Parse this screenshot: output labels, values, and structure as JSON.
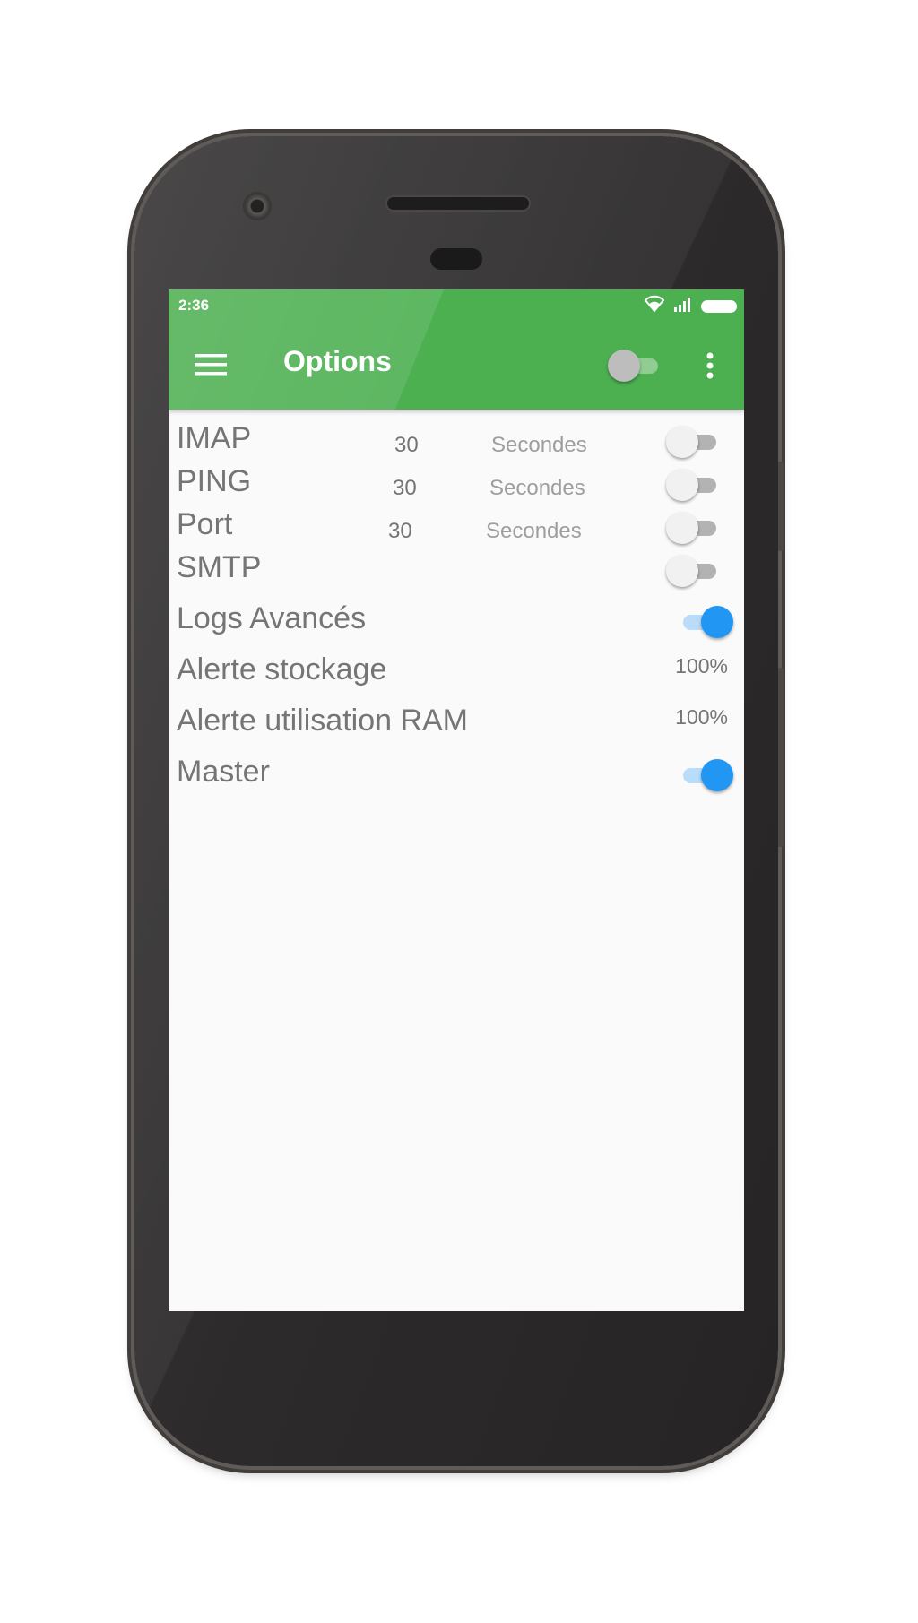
{
  "status_bar": {
    "time": "2:36"
  },
  "app_bar": {
    "title": "Options",
    "color": "#4caf50",
    "master_toggle_on": false
  },
  "settings": {
    "imap": {
      "label": "IMAP",
      "value": "30",
      "unit": "Secondes",
      "enabled": false
    },
    "ping": {
      "label": "PING",
      "value": "30",
      "unit": "Secondes",
      "enabled": false
    },
    "port": {
      "label": "Port",
      "value": "30",
      "unit": "Secondes",
      "enabled": false
    },
    "smtp": {
      "label": "SMTP",
      "enabled": false
    },
    "logs": {
      "label": "Logs Avancés",
      "enabled": true
    },
    "storage_alert": {
      "label": "Alerte stockage",
      "value": "100%"
    },
    "ram_alert": {
      "label": "Alerte utilisation RAM",
      "value": "100%"
    },
    "master": {
      "label": "Master",
      "enabled": true
    }
  },
  "icons": {
    "menu": "hamburger-menu-icon",
    "more": "more-vert-icon",
    "wifi": "wifi-icon",
    "signal": "cell-signal-icon",
    "battery": "battery-icon"
  },
  "accent_color": "#2196f3"
}
